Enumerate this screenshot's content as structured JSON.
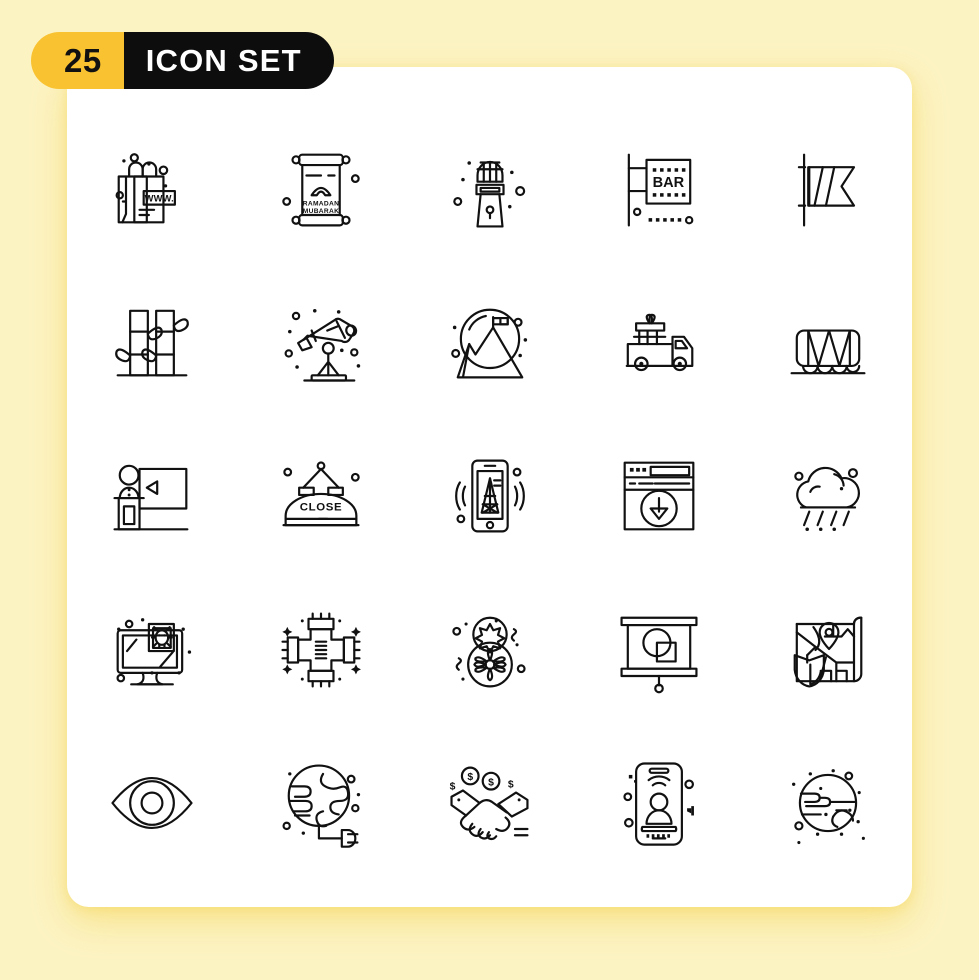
{
  "background_color": "#FCF3C3",
  "card_color": "#FFFFFF",
  "header": {
    "count": "25",
    "title": "ICON SET",
    "count_bg": "#F9C231",
    "title_bg": "#0D0D0D",
    "count_text_color": "#111111",
    "title_text_color": "#FFFFFF"
  },
  "grid": {
    "columns": 5,
    "rows": 5,
    "total": 25,
    "stroke_color": "#111111"
  },
  "icons": [
    {
      "index": 1,
      "name": "shopping-bag-online",
      "label": "Online Shopping Bag",
      "embedded_text": "WWW."
    },
    {
      "index": 2,
      "name": "ramadan-mubarak-scroll",
      "label": "Ramadan Mubarak Scroll",
      "embedded_text": "RAMADAN MUBARAK"
    },
    {
      "index": 3,
      "name": "microphone",
      "label": "Microphone",
      "embedded_text": ""
    },
    {
      "index": 4,
      "name": "bar-sign",
      "label": "Bar Signboard",
      "embedded_text": "BAR"
    },
    {
      "index": 5,
      "name": "striped-flag",
      "label": "Striped Flag",
      "embedded_text": ""
    },
    {
      "index": 6,
      "name": "bamboo-plant",
      "label": "Bamboo Plant",
      "embedded_text": ""
    },
    {
      "index": 7,
      "name": "telescope",
      "label": "Telescope",
      "embedded_text": ""
    },
    {
      "index": 8,
      "name": "mountain-summit-flag",
      "label": "Mountain Summit Flag",
      "embedded_text": ""
    },
    {
      "index": 9,
      "name": "gift-delivery-truck",
      "label": "Gift Delivery Truck",
      "embedded_text": ""
    },
    {
      "index": 10,
      "name": "drum",
      "label": "Drum",
      "embedded_text": ""
    },
    {
      "index": 11,
      "name": "presentation-speaker",
      "label": "Presentation Speaker",
      "embedded_text": ""
    },
    {
      "index": 12,
      "name": "close-hanging-sign",
      "label": "Close Hanging Sign",
      "embedded_text": "CLOSE"
    },
    {
      "index": 13,
      "name": "mobile-signal-tower",
      "label": "Mobile Signal Tower",
      "embedded_text": ""
    },
    {
      "index": 14,
      "name": "browser-download",
      "label": "Browser Download",
      "embedded_text": ""
    },
    {
      "index": 15,
      "name": "rain-cloud",
      "label": "Rain Cloud",
      "embedded_text": ""
    },
    {
      "index": 16,
      "name": "computer-virus",
      "label": "Computer Virus",
      "embedded_text": ""
    },
    {
      "index": 17,
      "name": "pipe-cross-joint",
      "label": "Pipe Cross Joint",
      "embedded_text": ""
    },
    {
      "index": 18,
      "name": "snowman-snowflake",
      "label": "Snowman with Snowflake",
      "embedded_text": ""
    },
    {
      "index": 19,
      "name": "projector-screen-chart",
      "label": "Projector Screen",
      "embedded_text": ""
    },
    {
      "index": 20,
      "name": "map-shield-location",
      "label": "Secure Map Location",
      "embedded_text": ""
    },
    {
      "index": 21,
      "name": "eye",
      "label": "Eye",
      "embedded_text": ""
    },
    {
      "index": 22,
      "name": "globe-power-plug",
      "label": "Global Energy Plug",
      "embedded_text": ""
    },
    {
      "index": 23,
      "name": "handshake-money",
      "label": "Money Handshake Deal",
      "embedded_text": "$"
    },
    {
      "index": 24,
      "name": "mobile-live-broadcast",
      "label": "Mobile Live Broadcast",
      "embedded_text": ""
    },
    {
      "index": 25,
      "name": "planet",
      "label": "Planet",
      "embedded_text": ""
    }
  ]
}
